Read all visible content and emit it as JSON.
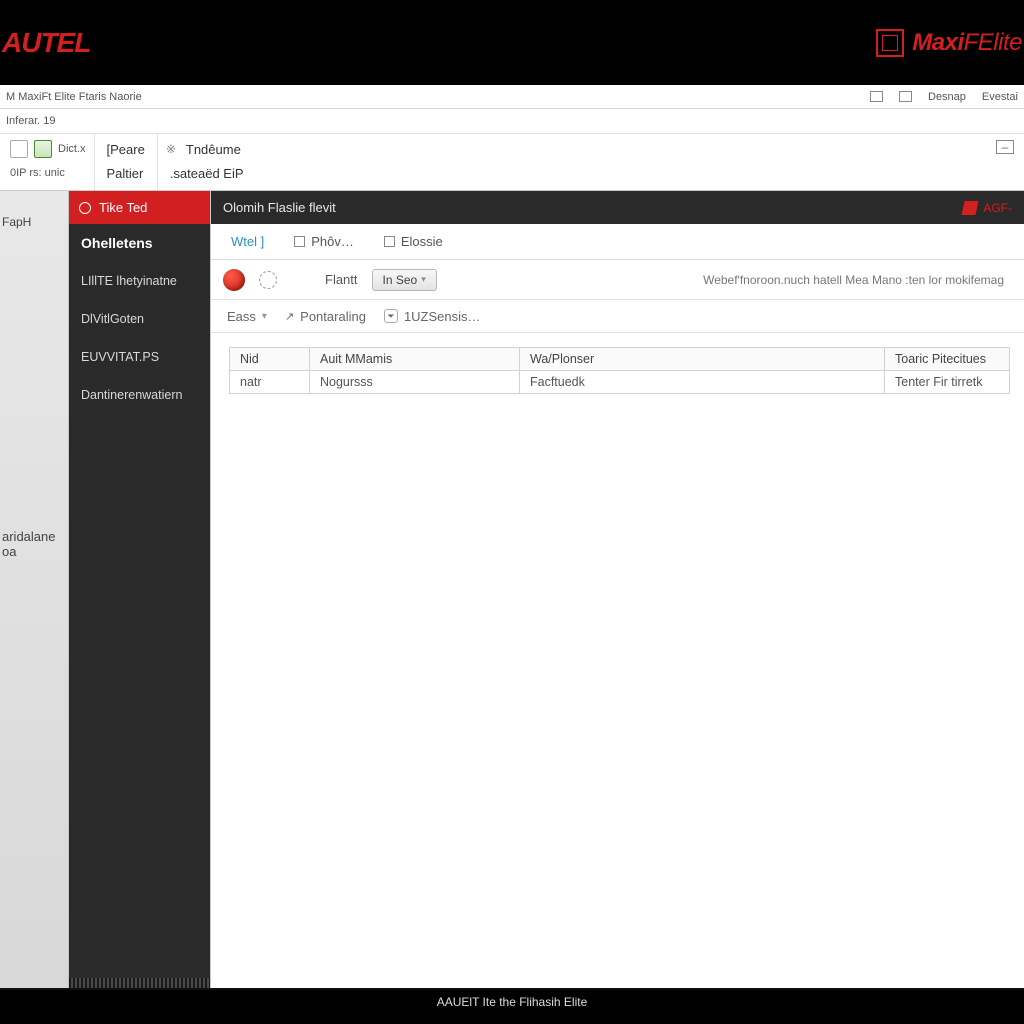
{
  "branding": {
    "logo_left": "AUTEL",
    "logo_right_main": "Maxi",
    "logo_right_bold": "FElite"
  },
  "titlebar": {
    "title": "M  MaxiFt Elite Ftaris Naorie",
    "right": {
      "link1": "Desnap",
      "link2": "Evestai"
    }
  },
  "subbar": {
    "text": "Inferar. 19"
  },
  "ribbon": {
    "group1": {
      "top_small": "",
      "bottom": "0IP  rs: unic"
    },
    "group2": {
      "btn1": "[Peare",
      "btn2": "Paltier",
      "icon_label": "Dict.x"
    },
    "group3": {
      "btn1": "Tndêume",
      "btn2": ".sateaëd EiP"
    }
  },
  "left_gutter": {
    "line1": "FapH",
    "line2a": "aridalane",
    "line2b": "oa"
  },
  "sidebar": {
    "active": "Tike Ted",
    "items": [
      {
        "label": "Ohelletens",
        "header": true
      },
      {
        "label": "LIllTE lhetyinatne"
      },
      {
        "label": "DlVitlGoten"
      },
      {
        "label": "EUVVITAT.PS"
      },
      {
        "label": "Dantinerenwatiern"
      }
    ]
  },
  "main": {
    "header_title": "Olomih Flaslie flevit",
    "header_right": "AGF-",
    "tabs": [
      {
        "label": "Wtel ]",
        "active": true
      },
      {
        "label": "Phôv…"
      },
      {
        "label": "Elossie"
      }
    ],
    "action": {
      "label1": "Flantt",
      "button": "In Seo",
      "hint": "Webef'fnoroon.nuch hatell Mea Mano :ten  lor mokifemag"
    },
    "filters": {
      "f1": "Eass",
      "f2": "Pontaraling",
      "f3": "1UZSensis…"
    },
    "table": {
      "headers": [
        "Nid",
        "Auit MMamis",
        "Wa/Plonser",
        "Toaric Pitecitues"
      ],
      "rows": [
        [
          "natr",
          "Nogursss",
          "Facftuedk",
          "Tenter Fir tirretk"
        ]
      ]
    }
  },
  "footer": {
    "text": "AAUElT Ite the Flihasih Elite"
  }
}
